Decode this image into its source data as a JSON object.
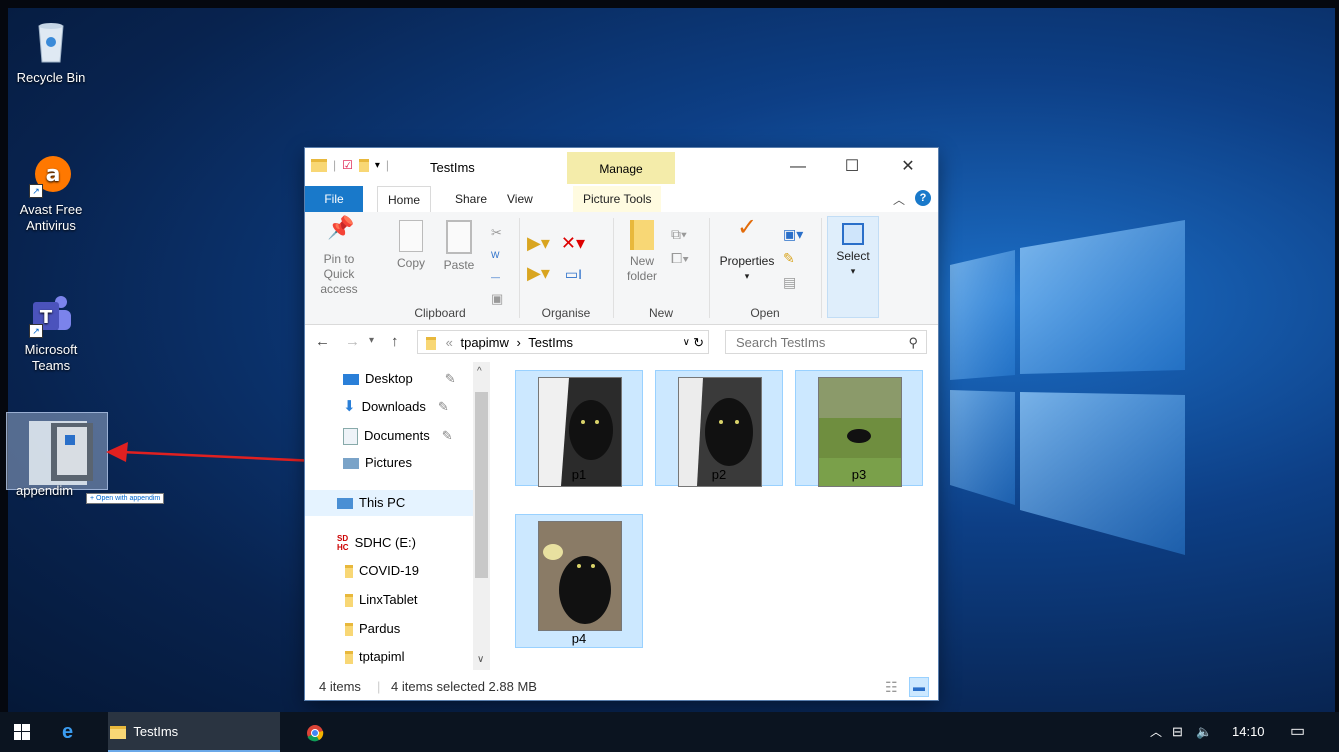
{
  "desktop": {
    "icons": [
      {
        "label": "Recycle Bin"
      },
      {
        "label": "Avast Free Antivirus"
      },
      {
        "label": "Microsoft Teams"
      },
      {
        "label": "appendim"
      }
    ],
    "drag_tooltip": "+ Open with appendim"
  },
  "explorer": {
    "title": "TestIms",
    "context_tab": "Manage",
    "tabs": [
      "File",
      "Home",
      "Share",
      "View",
      "Picture Tools"
    ],
    "ribbon": {
      "clipboard": {
        "pin": "Pin to Quick access",
        "copy": "Copy",
        "paste": "Paste",
        "label": "Clipboard"
      },
      "organise": {
        "label": "Organise"
      },
      "new": {
        "new_folder": "New folder",
        "label": "New"
      },
      "open": {
        "properties": "Properties",
        "label": "Open"
      },
      "select": {
        "select": "Select"
      }
    },
    "address": {
      "root": "tpapimw",
      "current": "TestIms",
      "separator": "›",
      "prefix": "«"
    },
    "search_placeholder": "Search TestIms",
    "nav": [
      {
        "label": "Desktop"
      },
      {
        "label": "Downloads"
      },
      {
        "label": "Documents"
      },
      {
        "label": "Pictures"
      },
      {
        "label": "This PC"
      },
      {
        "label": "SDHC (E:)"
      },
      {
        "label": "COVID-19"
      },
      {
        "label": "LinxTablet"
      },
      {
        "label": "Pardus"
      },
      {
        "label": "tptapiml"
      }
    ],
    "files": [
      {
        "name": "p1"
      },
      {
        "name": "p2"
      },
      {
        "name": "p3"
      },
      {
        "name": "p4"
      }
    ],
    "status": {
      "count": "4 items",
      "selected": "4 items selected 2.88 MB"
    }
  },
  "taskbar": {
    "active_window": "TestIms",
    "time": "14:10"
  },
  "colors": {
    "accent": "#1979ca",
    "selection": "#cce8ff",
    "arrow": "#e02020"
  }
}
